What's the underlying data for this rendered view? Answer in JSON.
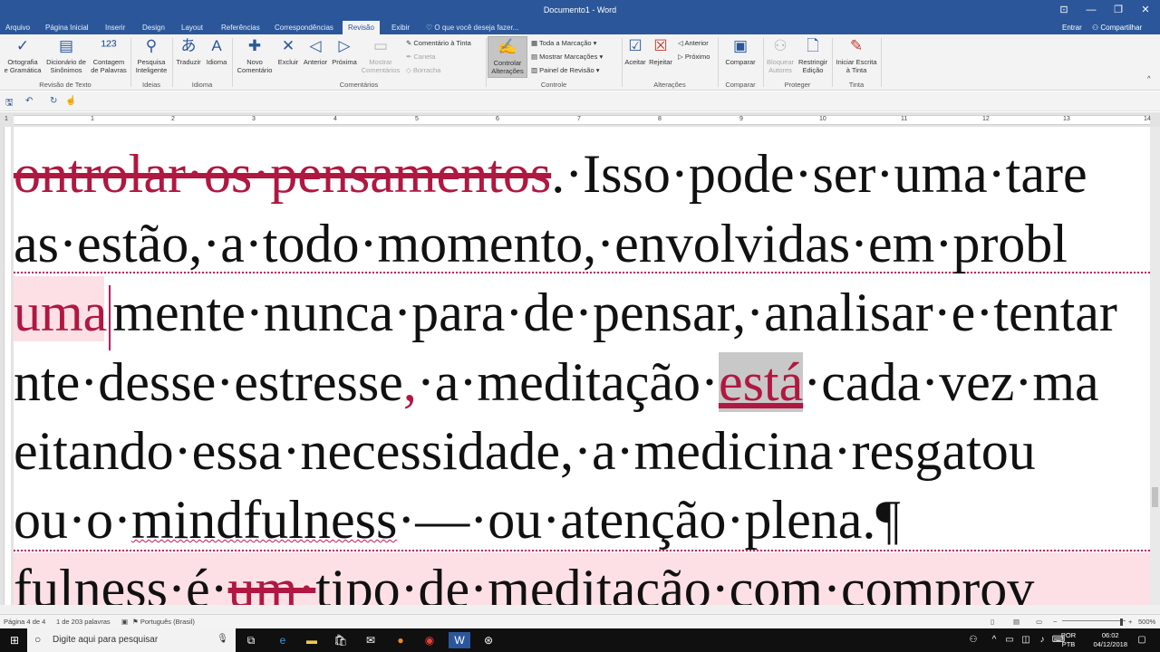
{
  "window": {
    "title": "Documento1 - Word",
    "controls": [
      "⊡",
      "—",
      "❐",
      "✕"
    ]
  },
  "tabs": {
    "items": [
      "Arquivo",
      "Página Inicial",
      "Inserir",
      "Design",
      "Layout",
      "Referências",
      "Correspondências",
      "Revisão",
      "Exibir"
    ],
    "active": "Revisão",
    "tell_me": "O que você deseja fazer...",
    "signin": "Entrar",
    "share": "Compartilhar"
  },
  "ribbon": {
    "spelling": "Ortografia\ne Gramática",
    "thesaurus": "Dicionário de\nSinônimos",
    "word_count": "Contagem\nde Palavras",
    "group_proofing": "Revisão de Texto",
    "smart_lookup": "Pesquisa\nInteligente",
    "group_insights": "Ideias",
    "translate": "Traduzir",
    "language": "Idioma",
    "group_language": "Idioma",
    "new_comment": "Novo\nComentário",
    "delete": "Excluir",
    "previous": "Anterior",
    "next": "Próxima",
    "show_comments": "Mostrar\nComentários",
    "ink_comment": "Comentário à Tinta",
    "pen": "Caneta",
    "eraser": "Borracha",
    "group_comments": "Comentários",
    "track_changes": "Controlar\nAlterações",
    "markup_select": "Toda a Marcação",
    "show_markup": "Mostrar Marcações",
    "reviewing_pane": "Painel de Revisão",
    "group_tracking": "Controle",
    "accept": "Aceitar",
    "reject": "Rejeitar",
    "prev_change": "Anterior",
    "next_change": "Próximo",
    "group_changes": "Alterações",
    "compare": "Comparar",
    "group_compare": "Comparar",
    "block_authors": "Bloquear\nAutores",
    "restrict_editing": "Restringir\nEdição",
    "group_protect": "Proteger",
    "start_inking": "Iniciar Escrita\nà Tinta",
    "group_ink": "Tinta"
  },
  "ruler": [
    "1",
    "1",
    "2",
    "3",
    "4",
    "5",
    "6",
    "7",
    "8",
    "9",
    "10",
    "11",
    "12",
    "13",
    "14"
  ],
  "document": {
    "line1_del": "ontrolar·os·pensamentos",
    "line1_rest": ".·Isso·pode·ser·uma·tare",
    "line2": "as·estão,·a·todo·momento,·envolvidas·em·probl",
    "line3_pink": "uma",
    "line3_rest": "mente·nunca·para·de·pensar,·analisar·e·tentar",
    "line4_a": "nte·desse·estresse",
    "line4_ins": ",",
    "line4_b": "·a·meditação·",
    "line4_hl": "está",
    "line4_c": "·cada·vez·ma",
    "line5": "eitando·essa·necessidade,·a·medicina·resgatou",
    "line6_a": "ou·o·",
    "line6_spell": "mindfulness",
    "line6_b": "·—·ou·atenção·plena.¶",
    "line7_a": "fulness·é·",
    "line7_del": "um·",
    "line7_b": "tipo·de·meditação·com·comprov"
  },
  "status": {
    "page": "Página 4 de 4",
    "words": "1 de 203 palavras",
    "language": "Português (Brasil)",
    "zoom": "500%"
  },
  "taskbar": {
    "search_placeholder": "Digite aqui para pesquisar",
    "lang": "POR\nPTB",
    "time": "06:02",
    "date": "04/12/2018"
  }
}
